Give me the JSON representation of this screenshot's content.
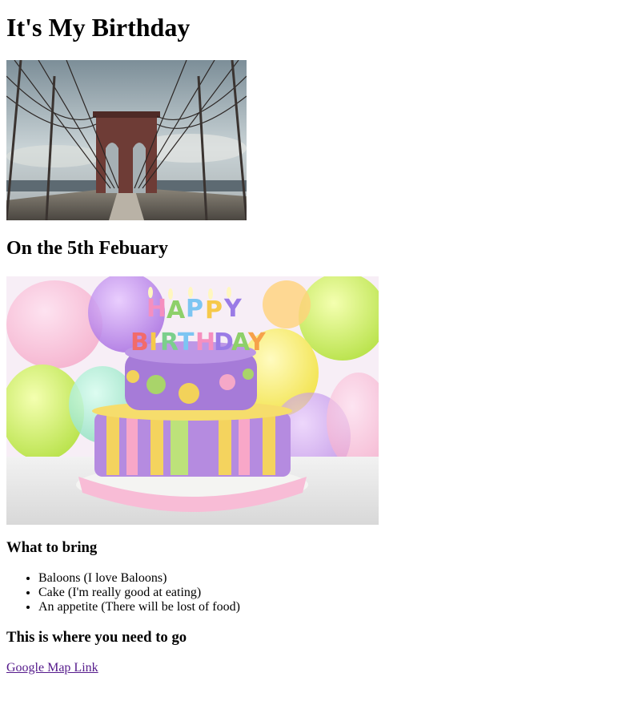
{
  "heading": "It's My Birthday",
  "subheading": "On the 5th Febuary",
  "bring": {
    "title": "What to bring",
    "items": [
      "Baloons (I love Baloons)",
      "Cake (I'm really good at eating)",
      "An appetite (There will be lost of food)"
    ]
  },
  "directions": {
    "title": "This is where you need to go",
    "link_text": "Google Map Link"
  },
  "colors": {
    "link_visited": "#551a8b"
  }
}
